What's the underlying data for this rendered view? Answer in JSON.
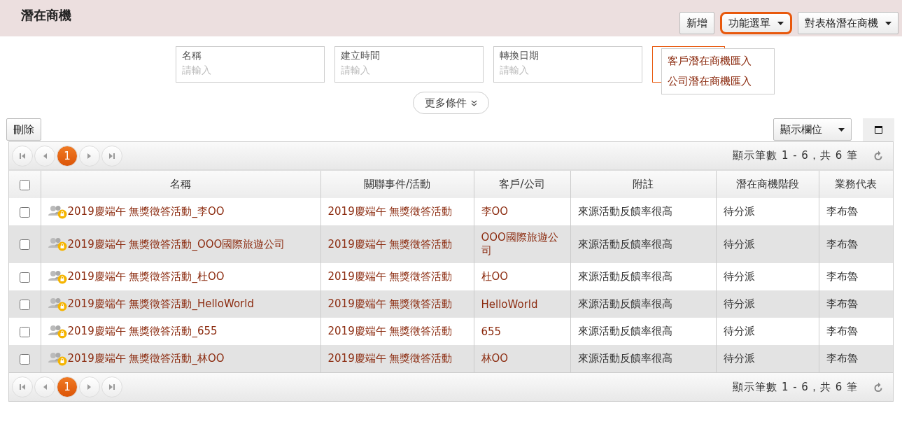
{
  "page_title": "潛在商機",
  "header_buttons": [
    {
      "label": "新增",
      "kind": "plain",
      "highlighted": false
    },
    {
      "label": "功能選單",
      "kind": "dropdown",
      "highlighted": true
    },
    {
      "label": "對表格潛在商機",
      "kind": "dropdown",
      "highlighted": false
    }
  ],
  "menu": {
    "items": [
      "客戶潛在商機匯入",
      "公司潛在商機匯入"
    ]
  },
  "filters": [
    {
      "label": "名稱",
      "placeholder": "請輸入"
    },
    {
      "label": "建立時間",
      "placeholder": "請輸入"
    },
    {
      "label": "轉換日期",
      "placeholder": "請輸入"
    }
  ],
  "more_button": "更多條件",
  "delete_button": "刪除",
  "columns_button": "顯示欄位",
  "pager_top": {
    "pages": [
      {
        "label": "1",
        "selected": true
      }
    ],
    "info": "顯示筆數 1 - 6，共 6 筆"
  },
  "table": {
    "columns": [
      "名稱",
      "關聯事件/活動",
      "客戶/公司",
      "附註",
      "潛在商機階段",
      "業務代表"
    ],
    "header_checked": false,
    "rows": [
      {
        "checked": false,
        "name": "2019慶端午 無獎徵答活動_李OO",
        "event": "2019慶端午 無獎徵答活動",
        "client": "李OO",
        "note": "來源活動反饋率很高",
        "stage": "待分派",
        "rep": "李布魯"
      },
      {
        "checked": false,
        "name": "2019慶端午 無獎徵答活動_OOO國際旅遊公司",
        "event": "2019慶端午 無獎徵答活動",
        "client": "OOO國際旅遊公司",
        "note": "來源活動反饋率很高",
        "stage": "待分派",
        "rep": "李布魯"
      },
      {
        "checked": false,
        "name": "2019慶端午 無獎徵答活動_杜OO",
        "event": "2019慶端午 無獎徵答活動",
        "client": "杜OO",
        "note": "來源活動反饋率很高",
        "stage": "待分派",
        "rep": "李布魯"
      },
      {
        "checked": false,
        "name": "2019慶端午 無獎徵答活動_HelloWorld",
        "event": "2019慶端午 無獎徵答活動",
        "client": "HelloWorld",
        "note": "來源活動反饋率很高",
        "stage": "待分派",
        "rep": "李布魯"
      },
      {
        "checked": false,
        "name": "2019慶端午 無獎徵答活動_655",
        "event": "2019慶端午 無獎徵答活動",
        "client": "655",
        "note": "來源活動反饋率很高",
        "stage": "待分派",
        "rep": "李布魯"
      },
      {
        "checked": false,
        "name": "2019慶端午 無獎徵答活動_林OO",
        "event": "2019慶端午 無獎徵答活動",
        "client": "林OO",
        "note": "來源活動反饋率很高",
        "stage": "待分派",
        "rep": "李布魯"
      }
    ]
  },
  "pager_bottom": {
    "pages": [
      {
        "label": "1",
        "selected": true
      }
    ],
    "info": "顯示筆數 1 - 6，共 6 筆"
  }
}
